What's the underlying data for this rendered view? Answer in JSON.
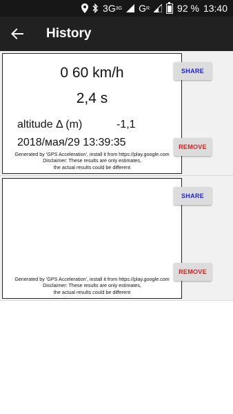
{
  "status_bar": {
    "network": "3G",
    "network_sub": "3G",
    "network2": "G",
    "network2_sub": "R",
    "battery": "92 %",
    "time": "13:40",
    "icons": [
      "location-icon",
      "bluetooth-icon",
      "signal-icon",
      "signal-icon",
      "battery-icon"
    ]
  },
  "app_bar": {
    "title": "History",
    "back_icon": "arrow-left-icon"
  },
  "entries": [
    {
      "speed_range": "0 60 km/h",
      "time": "2,4 s",
      "altitude_label": "altitude Δ (m)",
      "altitude_value": "-1,1",
      "timestamp": "2018/мая/29 13:39:35",
      "footer_line1": "Generated by 'GPS Acceleration', install it from https://play.google.com",
      "footer_line2": "Disclaimer: These results are only estimates,",
      "footer_line3": "the actual results could be different",
      "share_label": "SHARE",
      "remove_label": "REMOVE"
    },
    {
      "speed_range": "",
      "time": "",
      "altitude_label": "",
      "altitude_value": "",
      "timestamp": "",
      "footer_line1": "Generated by 'GPS Acceleration', install it from https://play.google.com",
      "footer_line2": "Disclaimer: These results are only estimates,",
      "footer_line3": "the actual results could be different",
      "share_label": "SHARE",
      "remove_label": "REMOVE"
    }
  ],
  "colors": {
    "status_bar": "#171717",
    "app_bar": "#212121",
    "share": "#2323d6",
    "remove": "#d42020"
  }
}
